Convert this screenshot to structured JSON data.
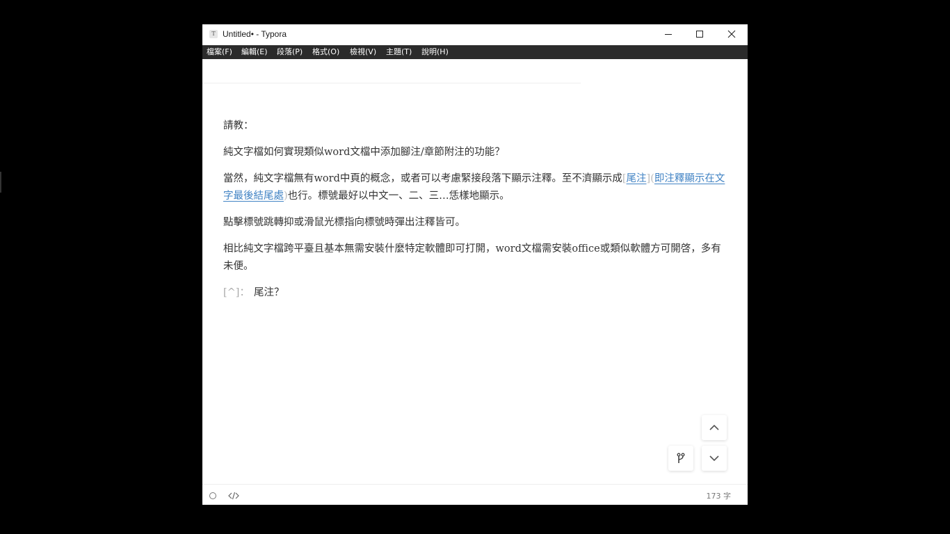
{
  "window": {
    "title": "Untitled• - Typora",
    "app_icon_letter": "T"
  },
  "menubar": {
    "items": [
      {
        "label": "檔案(F)"
      },
      {
        "label": "編輯(E)"
      },
      {
        "label": "段落(P)"
      },
      {
        "label": "格式(O)"
      },
      {
        "label": "檢視(V)"
      },
      {
        "label": "主題(T)"
      },
      {
        "label": "說明(H)"
      }
    ]
  },
  "document": {
    "p1": "請教：",
    "p2": "純文字檔如何實現類似word文檔中添加腳注/章節附注的功能？",
    "p3": {
      "before": "當然，純文字檔無有word中頁的概念，或者可以考慮緊接段落下顯示注釋。至不濟顯示成",
      "mark_open": "[",
      "link1": "尾注",
      "mark_mid": "](",
      "link2": "即注釋顯示在文字最後結尾處",
      "mark_close": ")",
      "after": "也行。標號最好以中文一、二、三…恁樣地顯示。"
    },
    "p4": "點擊標號跳轉抑或滑鼠光標指向標號時彈出注釋皆可。",
    "p5": "相比純文字檔跨平臺且基本無需安裝什麼特定軟體即可打開，word文檔需安裝office或類似軟體方可開啓，多有未便。",
    "footnote": {
      "marker": "[^]：",
      "text": "尾注？"
    }
  },
  "statusbar": {
    "word_count": "173 字"
  },
  "colors": {
    "menubar_bg": "#2b2b2b",
    "link": "#4183c4",
    "text": "#333333"
  }
}
